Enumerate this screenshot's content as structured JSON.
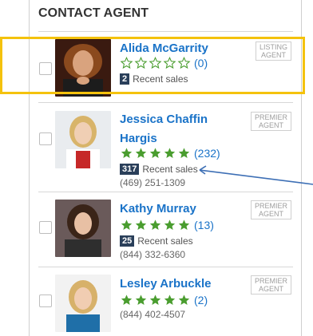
{
  "panel": {
    "title": "CONTACT AGENT"
  },
  "agents": [
    {
      "name_line1": "Alida McGarrity",
      "name_line2": "",
      "badge_line1": "LISTING",
      "badge_line2": "AGENT",
      "rating_count": "(0)",
      "stars_filled": 0,
      "sales_num": "2",
      "sales_label": "Recent sales",
      "phone": ""
    },
    {
      "name_line1": "Jessica Chaffin",
      "name_line2": "Hargis",
      "badge_line1": "PREMIER",
      "badge_line2": "AGENT",
      "rating_count": "(232)",
      "stars_filled": 5,
      "sales_num": "317",
      "sales_label": "Recent sales",
      "phone": "(469) 251-1309"
    },
    {
      "name_line1": "Kathy Murray",
      "name_line2": "",
      "badge_line1": "PREMIER",
      "badge_line2": "AGENT",
      "rating_count": "(13)",
      "stars_filled": 5,
      "sales_num": "25",
      "sales_label": "Recent sales",
      "phone": "(844) 332-6360"
    },
    {
      "name_line1": "Lesley Arbuckle",
      "name_line2": "",
      "badge_line1": "PREMIER",
      "badge_line2": "AGENT",
      "rating_count": "(2)",
      "stars_filled": 5,
      "sales_num": "",
      "sales_label": "",
      "phone": "(844) 402-4507"
    }
  ],
  "colors": {
    "link_blue": "#1a73c8",
    "star_green": "#4a9d2f",
    "sales_badge": "#2a3f5a",
    "highlight_yellow": "#f4c20d",
    "arrow_blue": "#3d6fb5"
  },
  "icons": {
    "star": "star-icon",
    "photo": "agent-photo",
    "checkbox": "checkbox"
  }
}
